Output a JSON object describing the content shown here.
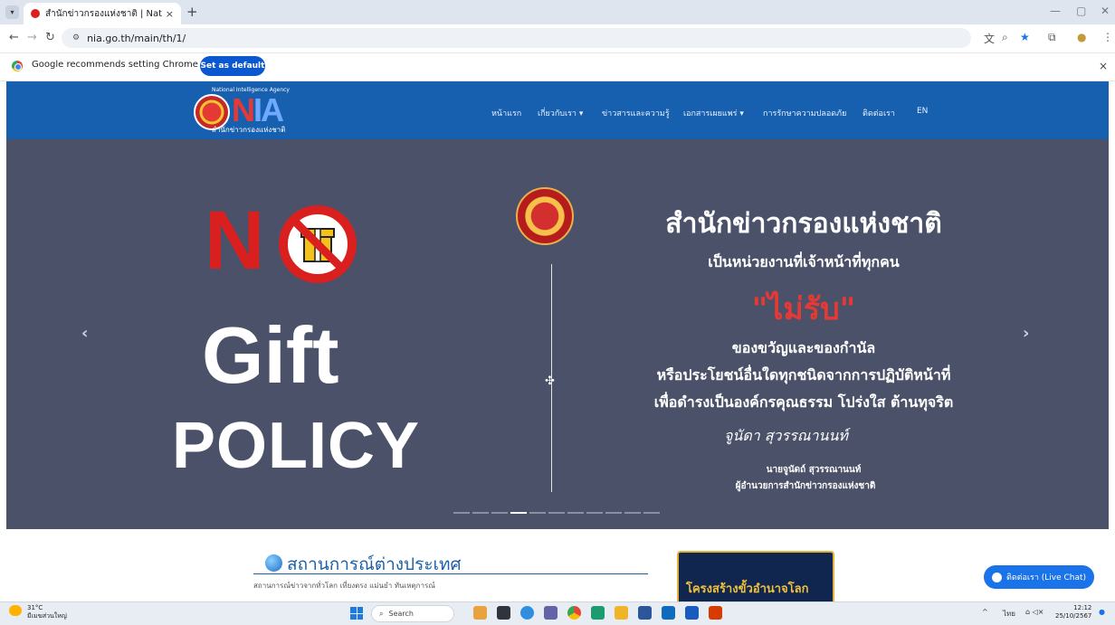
{
  "browser": {
    "tab_title": "สำนักข่าวกรองแห่งชาติ | National I",
    "tab_close": "×",
    "new_tab": "+",
    "url": "nia.go.th/main/th/1/",
    "win_controls": [
      "—",
      "▢",
      "✕"
    ]
  },
  "infobar": {
    "message": "Google recommends setting Chrome as default",
    "button": "Set as default",
    "close": "×"
  },
  "site": {
    "logo_small": "National Intelligence Agency",
    "logo_nia_n": "N",
    "logo_nia_rest": "IA",
    "logo_thai": "สำนักข่าวกรองแห่งชาติ",
    "nav": [
      "หน้าแรก",
      "เกี่ยวกับเรา ▾",
      "ข่าวสารและความรู้",
      "เอกสารเผยแพร่ ▾",
      "การรักษาความปลอดภัย",
      "ติดต่อเรา",
      "EN"
    ]
  },
  "hero": {
    "no_n": "N",
    "gift": "Gift",
    "policy": "POLICY",
    "title": "สำนักข่าวกรองแห่งชาติ",
    "subtitle": "เป็นหน่วยงานที่เจ้าหน้าที่ทุกคน",
    "no_receive": "\"ไม่รับ\"",
    "line1": "ของขวัญและของกำนัล",
    "line2": "หรือประโยชน์อื่นใดทุกชนิดจากการปฏิบัติหน้าที่",
    "line3": "เพื่อดำรงเป็นองค์กรคุณธรรม โปร่งใส ต้านทุจริต",
    "signature": "จูนัดา สุวรรณานนท์",
    "signer_name": "นายจูนัดถ์ สุวรรณานนท์",
    "signer_position": "ผู้อำนวยการสำนักข่าวกรองแห่งชาติ",
    "prev": "‹",
    "next": "›",
    "slide_count": 11,
    "active_slide": 3
  },
  "content": {
    "section_title": "สถานการณ์ต่างประเทศ",
    "section_desc": "สถานการณ์ข่าวจากทั่วโลก เที่ยงตรง แม่นยำ ทันเหตุการณ์",
    "promo_text": "โครงสร้างขั้วอำนาจโลก",
    "live_chat": "ติดต่อเรา (Live Chat)"
  },
  "taskbar": {
    "temp": "31°C",
    "weather": "มีเมฆส่วนใหญ่",
    "search": "Search",
    "lang": "ไทย",
    "time": "12:12",
    "date": "25/10/2567"
  },
  "colors": {
    "header_blue": "#1760b0",
    "hero_bg": "#4a5168",
    "red": "#d9201f",
    "link_blue": "#1c5fa8",
    "chrome_blue": "#0b57d0"
  }
}
